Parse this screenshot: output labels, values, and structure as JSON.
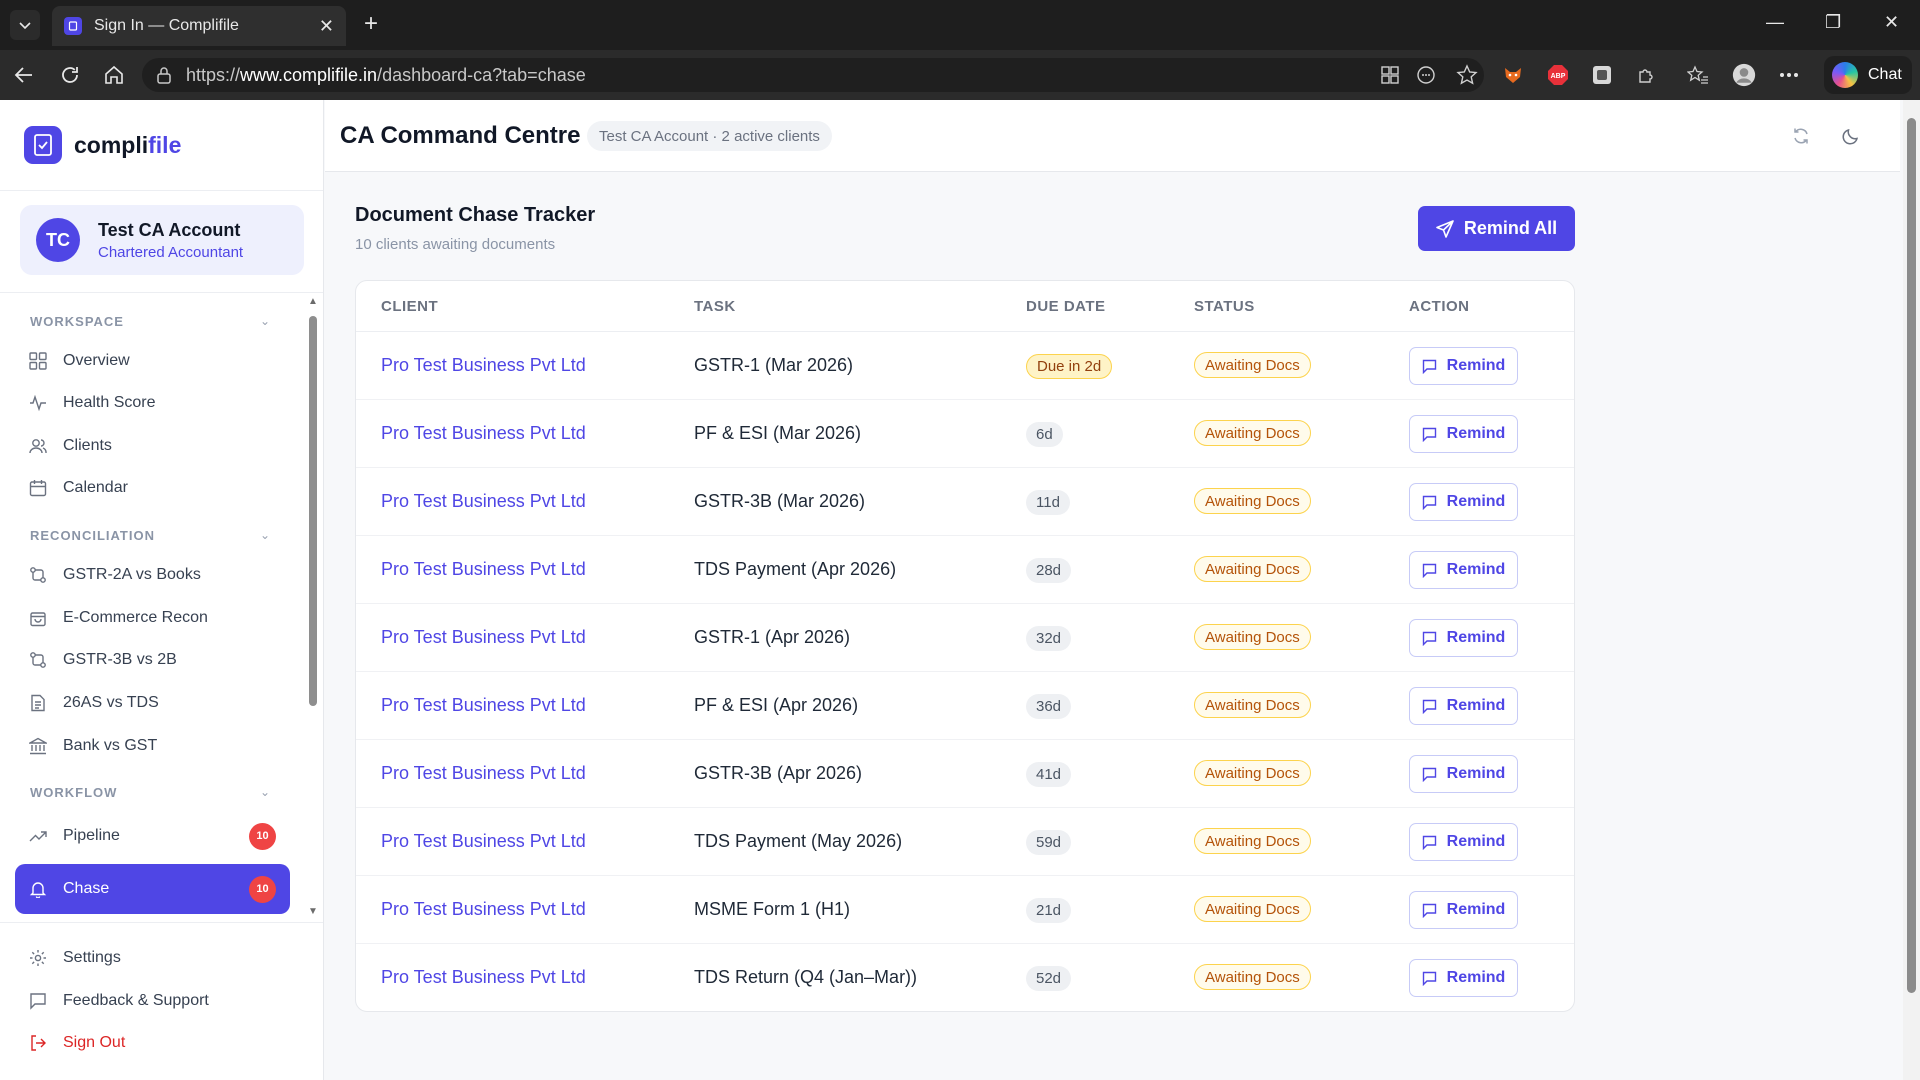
{
  "browser": {
    "tab_title": "Sign In — Complifile",
    "url_prefix": "https://",
    "url_domain": "www.complifile.in",
    "url_path": "/dashboard-ca?tab=chase",
    "chat_label": "Chat",
    "abp_label": "ABP"
  },
  "brand": {
    "name_part1": "compli",
    "name_part2": "file",
    "accent": "#4f46e5"
  },
  "profile": {
    "initials": "TC",
    "name": "Test CA Account",
    "role": "Chartered Accountant"
  },
  "sidebar": {
    "sections": [
      {
        "label": "WORKSPACE",
        "items": [
          "Overview",
          "Health Score",
          "Clients",
          "Calendar"
        ]
      },
      {
        "label": "RECONCILIATION",
        "items": [
          "GSTR-2A vs Books",
          "E-Commerce Recon",
          "GSTR-3B vs 2B",
          "26AS vs TDS",
          "Bank vs GST"
        ]
      },
      {
        "label": "WORKFLOW",
        "items": [
          "Pipeline",
          "Chase"
        ]
      }
    ],
    "pipeline_badge": "10",
    "chase_badge": "10",
    "footer": [
      "Settings",
      "Feedback & Support",
      "Sign Out"
    ]
  },
  "header": {
    "title": "CA Command Centre",
    "pill": "Test CA Account · 2 active clients"
  },
  "tracker": {
    "title": "Document Chase Tracker",
    "subtitle": "10 clients awaiting documents",
    "remind_all": "Remind All",
    "columns": [
      "CLIENT",
      "TASK",
      "DUE DATE",
      "STATUS",
      "ACTION"
    ],
    "remind_label": "Remind",
    "rows": [
      {
        "client": "Pro Test Business Pvt Ltd",
        "task": "GSTR-1 (Mar 2026)",
        "due": "Due in 2d",
        "status": "Awaiting Docs"
      },
      {
        "client": "Pro Test Business Pvt Ltd",
        "task": "PF & ESI (Mar 2026)",
        "due": "6d",
        "status": "Awaiting Docs"
      },
      {
        "client": "Pro Test Business Pvt Ltd",
        "task": "GSTR-3B (Mar 2026)",
        "due": "11d",
        "status": "Awaiting Docs"
      },
      {
        "client": "Pro Test Business Pvt Ltd",
        "task": "TDS Payment (Apr 2026)",
        "due": "28d",
        "status": "Awaiting Docs"
      },
      {
        "client": "Pro Test Business Pvt Ltd",
        "task": "GSTR-1 (Apr 2026)",
        "due": "32d",
        "status": "Awaiting Docs"
      },
      {
        "client": "Pro Test Business Pvt Ltd",
        "task": "PF & ESI (Apr 2026)",
        "due": "36d",
        "status": "Awaiting Docs"
      },
      {
        "client": "Pro Test Business Pvt Ltd",
        "task": "GSTR-3B (Apr 2026)",
        "due": "41d",
        "status": "Awaiting Docs"
      },
      {
        "client": "Pro Test Business Pvt Ltd",
        "task": "TDS Payment (May 2026)",
        "due": "59d",
        "status": "Awaiting Docs"
      },
      {
        "client": "Pro Test Business Pvt Ltd",
        "task": "MSME Form 1 (H1)",
        "due": "21d",
        "status": "Awaiting Docs"
      },
      {
        "client": "Pro Test Business Pvt Ltd",
        "task": "TDS Return (Q4 (Jan–Mar))",
        "due": "52d",
        "status": "Awaiting Docs"
      }
    ]
  }
}
